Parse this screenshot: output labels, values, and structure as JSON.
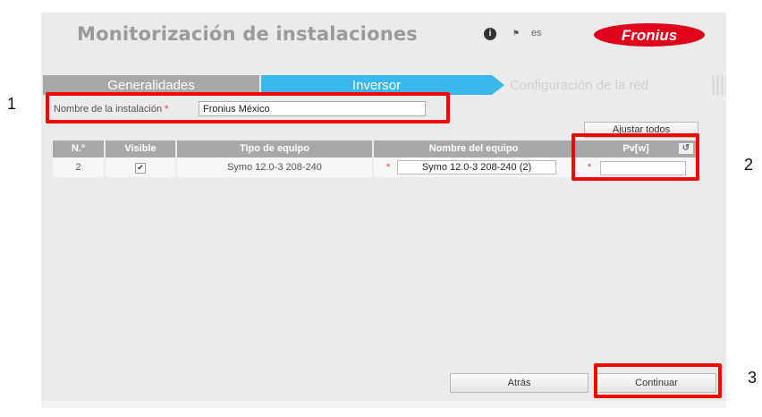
{
  "header": {
    "title": "Monitorización de instalaciones",
    "info_icon": "info-icon",
    "flag_icon": "flag-icon",
    "language": "es",
    "logo_text": "Fronius",
    "logo_color": "#e2001a"
  },
  "wizard": {
    "steps": [
      {
        "label": "Generalidades",
        "state": "done"
      },
      {
        "label": "Inversor",
        "state": "active"
      },
      {
        "label": "Configuración de la red",
        "state": "pending"
      }
    ]
  },
  "form": {
    "installation_label": "Nombre de la instalación",
    "required_mark": "*",
    "installation_value": "Fronius México"
  },
  "toolbar": {
    "adjust_all": "Ajustar todos"
  },
  "table": {
    "headers": [
      "N.º",
      "Visible",
      "Tipo de equipo",
      "Nombre del equipo",
      "Pv[w]"
    ],
    "rows": [
      {
        "number": "2",
        "visible": true,
        "device_type": "Symo 12.0-3 208-240",
        "device_name": "Symo 12.0-3 208-240 (2)",
        "pv": ""
      }
    ]
  },
  "buttons": {
    "back": "Atrás",
    "continue": "Continuar"
  },
  "annotations": [
    "1",
    "2",
    "3"
  ],
  "colors": {
    "accent": "#39b8ee",
    "highlight": "#ff0000",
    "header_gray": "#a8a8a8"
  }
}
